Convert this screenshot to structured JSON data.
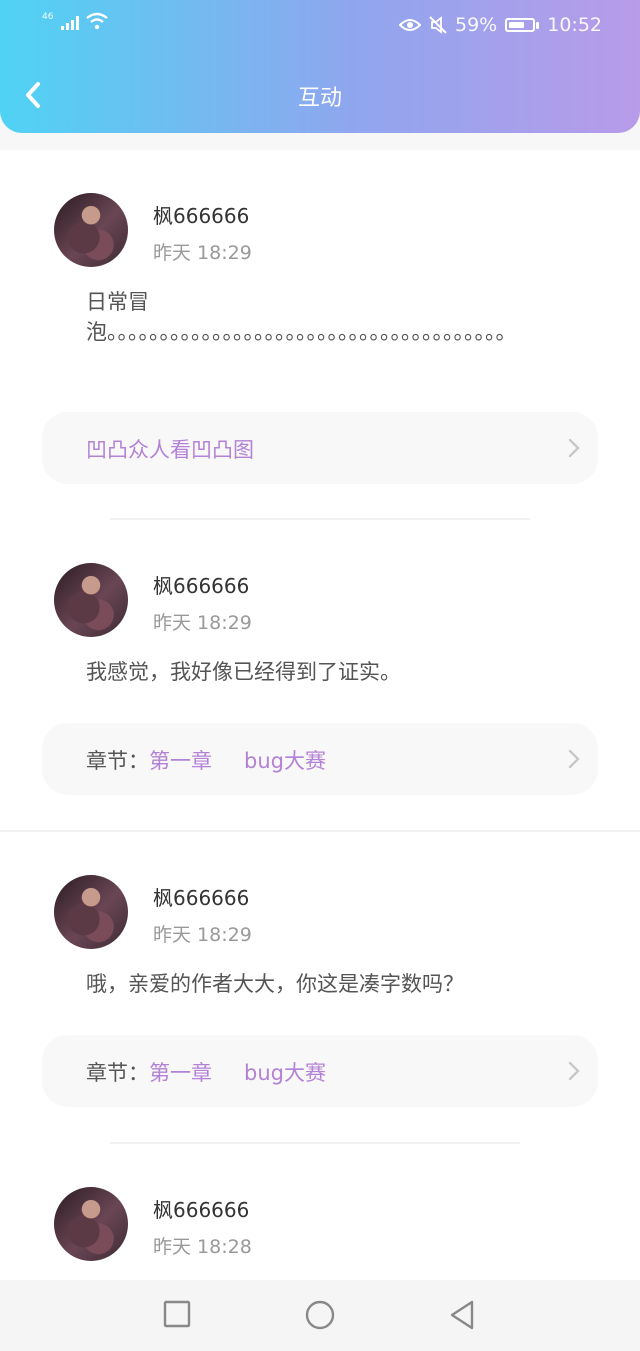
{
  "status_bar": {
    "network": "46",
    "battery": "59%",
    "time": "10:52"
  },
  "header": {
    "title": "互动"
  },
  "posts": [
    {
      "user": "枫666666",
      "time": "昨天 18:29",
      "text": "日常冒泡。。。。。。。。。。。。。。。。。。。。。。。。。。。。。。。。。。。。。。",
      "link": {
        "text": "凹凸众人看凹凸图"
      }
    },
    {
      "user": "枫666666",
      "time": "昨天 18:29",
      "text": "我感觉，我好像已经得到了证实。",
      "link": {
        "prefix": "章节：",
        "chapter": "第一章",
        "book": "bug大赛"
      }
    },
    {
      "user": "枫666666",
      "time": "昨天 18:29",
      "text": "哦，亲爱的作者大大，你这是凑字数吗？",
      "link": {
        "prefix": "章节：",
        "chapter": "第一章",
        "book": "bug大赛"
      }
    },
    {
      "user": "枫666666",
      "time": "昨天 18:28"
    }
  ],
  "colors": {
    "accent": "#b381d6",
    "header_start": "#4fd3f4",
    "header_end": "#b89be9"
  },
  "icons": [
    "back-arrow-icon",
    "eye-icon",
    "mute-icon",
    "wifi-icon",
    "signal-icon",
    "battery-icon",
    "chevron-right-icon",
    "square-nav-icon",
    "circle-nav-icon",
    "triangle-back-icon"
  ]
}
